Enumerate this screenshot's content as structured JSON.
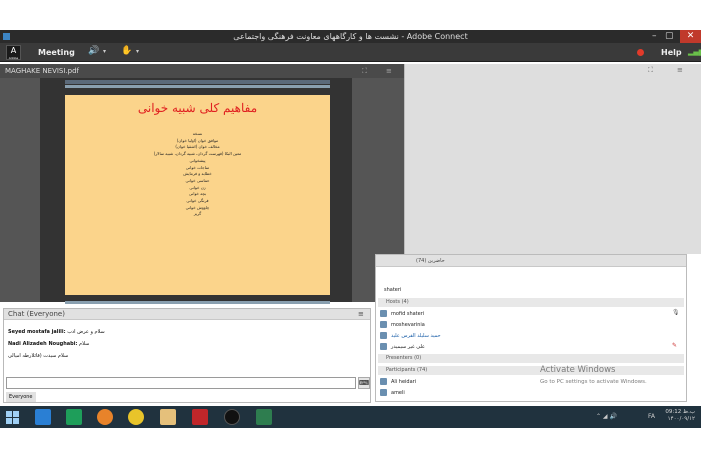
{
  "window": {
    "title": "نشست ها و کارگاههای معاونت فرهنگی واجتماعی - Adobe Connect",
    "minimize_label": "–",
    "restore_label": "▢",
    "close_label": "✕"
  },
  "menu": {
    "logo_label": "Adobe",
    "meeting_label": "Meeting",
    "help_label": "Help"
  },
  "share_pod": {
    "title": "MAGHAKE NEVISI.pdf"
  },
  "slide": {
    "title": "مفاهیم کلی شبیه خوانی",
    "lines": [
      "نسخه",
      "موافق خوان (اولیا خوان)",
      "مخالف خوان (اشقیا خوان)",
      "معین البکا (فهرست گردان، شبیه گردان، شبیه سالار)",
      "پیشخوانی",
      "مناجات خوانی",
      "خطابه و فرمایش",
      "حماسی خوانی",
      "زن خوانی",
      "بچه خوانی",
      "فرنگی خوانی",
      "چاووش خوانی",
      "گریز"
    ]
  },
  "attendee_pod": {
    "header": "حاضرین (74)",
    "top_name": "shateri",
    "hosts_label": "Hosts (4)",
    "hosts": [
      "mofid shateri",
      "moshevarinia",
      "حمید سلیلد القرس علید",
      "علی غیر سیمیدر"
    ],
    "presenters_label": "Presenters (0)",
    "participants_label": "Participants (74)",
    "participants": [
      "Ali heidari",
      "ameli"
    ]
  },
  "chat": {
    "title": "Chat (Everyone)",
    "messages": [
      {
        "name": "Seyed mostafa jalili:",
        "text": "سلام و عرض ادب"
      },
      {
        "name": "Nadi Alizadeh Noughabi:",
        "text": "سلام"
      },
      {
        "name": "",
        "text": "سلام سیدت (قائلارطه امیالی"
      }
    ],
    "tab_label": "Everyone",
    "send_label": "⌨"
  },
  "watermark": {
    "line1": "Activate Windows",
    "line2": "Go to PC settings to activate Windows."
  },
  "clock": {
    "time": "09:12 ب.ظ",
    "lang": "FA",
    "date": "۱۴۰۰/۰۹/۱۲"
  }
}
